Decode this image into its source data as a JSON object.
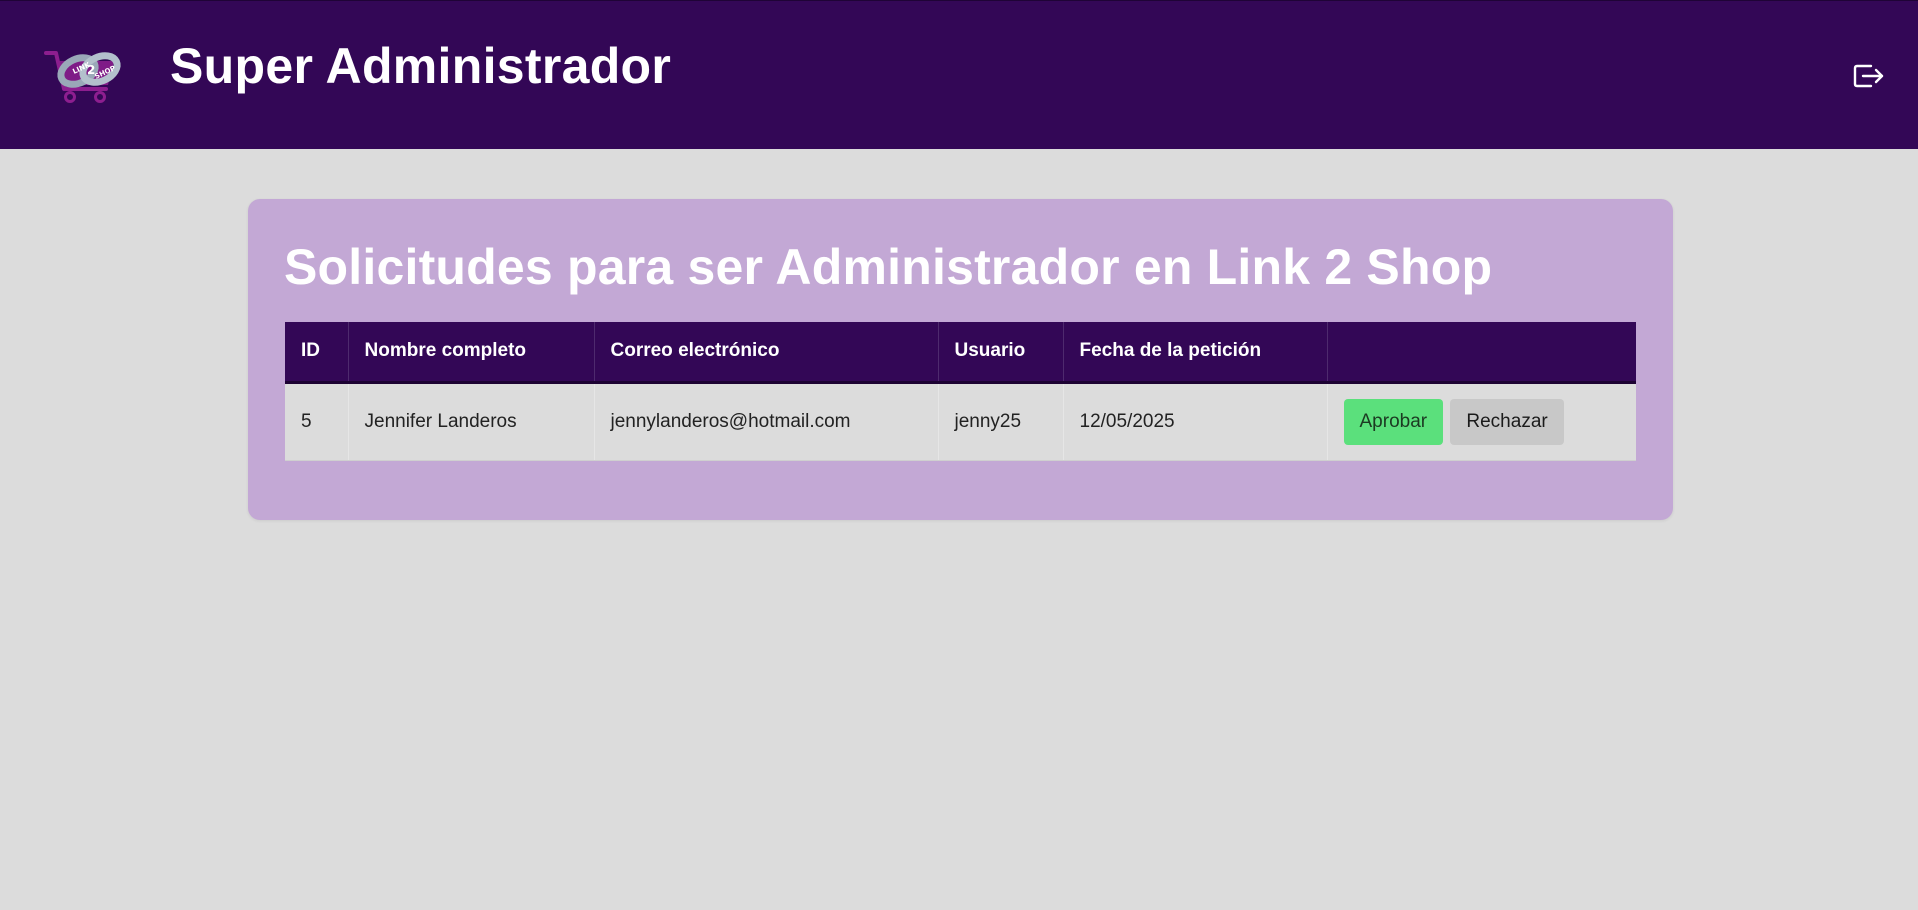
{
  "header": {
    "title": "Super Administrador",
    "logo_icon": "link-2-shop-logo",
    "logout_icon": "logout-icon",
    "colors": {
      "background": "#330756",
      "text": "#ffffff"
    }
  },
  "logo": {
    "text_top": "LINK",
    "text_mid": "2",
    "text_bottom": "SHOP"
  },
  "card": {
    "title": "Solicitudes para ser Administrador en Link 2 Shop",
    "colors": {
      "background": "#c3a8d5"
    }
  },
  "table": {
    "columns": [
      "ID",
      "Nombre completo",
      "Correo electrónico",
      "Usuario",
      "Fecha de la petición",
      ""
    ],
    "rows": [
      {
        "id": "5",
        "name": "Jennifer Landeros",
        "email": "jennylanderos@hotmail.com",
        "username": "jenny25",
        "date": "12/05/2025",
        "approve_label": "Aprobar",
        "reject_label": "Rechazar"
      }
    ],
    "colors": {
      "header": "#330756",
      "approve": "#5be07c",
      "reject": "#c8c8c8"
    }
  }
}
